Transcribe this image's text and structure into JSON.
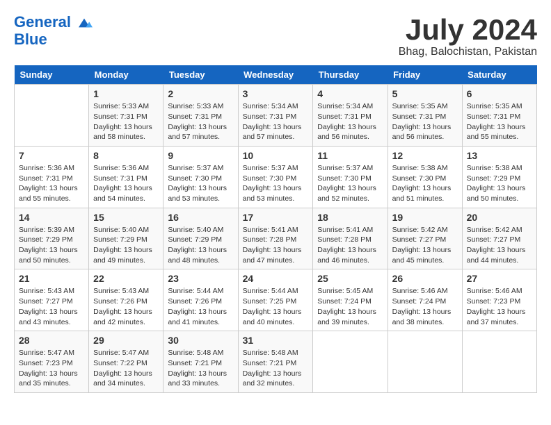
{
  "logo": {
    "line1": "General",
    "line2": "Blue"
  },
  "title": "July 2024",
  "location": "Bhag, Balochistan, Pakistan",
  "headers": [
    "Sunday",
    "Monday",
    "Tuesday",
    "Wednesday",
    "Thursday",
    "Friday",
    "Saturday"
  ],
  "weeks": [
    [
      {
        "day": "",
        "info": ""
      },
      {
        "day": "1",
        "info": "Sunrise: 5:33 AM\nSunset: 7:31 PM\nDaylight: 13 hours\nand 58 minutes."
      },
      {
        "day": "2",
        "info": "Sunrise: 5:33 AM\nSunset: 7:31 PM\nDaylight: 13 hours\nand 57 minutes."
      },
      {
        "day": "3",
        "info": "Sunrise: 5:34 AM\nSunset: 7:31 PM\nDaylight: 13 hours\nand 57 minutes."
      },
      {
        "day": "4",
        "info": "Sunrise: 5:34 AM\nSunset: 7:31 PM\nDaylight: 13 hours\nand 56 minutes."
      },
      {
        "day": "5",
        "info": "Sunrise: 5:35 AM\nSunset: 7:31 PM\nDaylight: 13 hours\nand 56 minutes."
      },
      {
        "day": "6",
        "info": "Sunrise: 5:35 AM\nSunset: 7:31 PM\nDaylight: 13 hours\nand 55 minutes."
      }
    ],
    [
      {
        "day": "7",
        "info": "Sunrise: 5:36 AM\nSunset: 7:31 PM\nDaylight: 13 hours\nand 55 minutes."
      },
      {
        "day": "8",
        "info": "Sunrise: 5:36 AM\nSunset: 7:31 PM\nDaylight: 13 hours\nand 54 minutes."
      },
      {
        "day": "9",
        "info": "Sunrise: 5:37 AM\nSunset: 7:30 PM\nDaylight: 13 hours\nand 53 minutes."
      },
      {
        "day": "10",
        "info": "Sunrise: 5:37 AM\nSunset: 7:30 PM\nDaylight: 13 hours\nand 53 minutes."
      },
      {
        "day": "11",
        "info": "Sunrise: 5:37 AM\nSunset: 7:30 PM\nDaylight: 13 hours\nand 52 minutes."
      },
      {
        "day": "12",
        "info": "Sunrise: 5:38 AM\nSunset: 7:30 PM\nDaylight: 13 hours\nand 51 minutes."
      },
      {
        "day": "13",
        "info": "Sunrise: 5:38 AM\nSunset: 7:29 PM\nDaylight: 13 hours\nand 50 minutes."
      }
    ],
    [
      {
        "day": "14",
        "info": "Sunrise: 5:39 AM\nSunset: 7:29 PM\nDaylight: 13 hours\nand 50 minutes."
      },
      {
        "day": "15",
        "info": "Sunrise: 5:40 AM\nSunset: 7:29 PM\nDaylight: 13 hours\nand 49 minutes."
      },
      {
        "day": "16",
        "info": "Sunrise: 5:40 AM\nSunset: 7:29 PM\nDaylight: 13 hours\nand 48 minutes."
      },
      {
        "day": "17",
        "info": "Sunrise: 5:41 AM\nSunset: 7:28 PM\nDaylight: 13 hours\nand 47 minutes."
      },
      {
        "day": "18",
        "info": "Sunrise: 5:41 AM\nSunset: 7:28 PM\nDaylight: 13 hours\nand 46 minutes."
      },
      {
        "day": "19",
        "info": "Sunrise: 5:42 AM\nSunset: 7:27 PM\nDaylight: 13 hours\nand 45 minutes."
      },
      {
        "day": "20",
        "info": "Sunrise: 5:42 AM\nSunset: 7:27 PM\nDaylight: 13 hours\nand 44 minutes."
      }
    ],
    [
      {
        "day": "21",
        "info": "Sunrise: 5:43 AM\nSunset: 7:27 PM\nDaylight: 13 hours\nand 43 minutes."
      },
      {
        "day": "22",
        "info": "Sunrise: 5:43 AM\nSunset: 7:26 PM\nDaylight: 13 hours\nand 42 minutes."
      },
      {
        "day": "23",
        "info": "Sunrise: 5:44 AM\nSunset: 7:26 PM\nDaylight: 13 hours\nand 41 minutes."
      },
      {
        "day": "24",
        "info": "Sunrise: 5:44 AM\nSunset: 7:25 PM\nDaylight: 13 hours\nand 40 minutes."
      },
      {
        "day": "25",
        "info": "Sunrise: 5:45 AM\nSunset: 7:24 PM\nDaylight: 13 hours\nand 39 minutes."
      },
      {
        "day": "26",
        "info": "Sunrise: 5:46 AM\nSunset: 7:24 PM\nDaylight: 13 hours\nand 38 minutes."
      },
      {
        "day": "27",
        "info": "Sunrise: 5:46 AM\nSunset: 7:23 PM\nDaylight: 13 hours\nand 37 minutes."
      }
    ],
    [
      {
        "day": "28",
        "info": "Sunrise: 5:47 AM\nSunset: 7:23 PM\nDaylight: 13 hours\nand 35 minutes."
      },
      {
        "day": "29",
        "info": "Sunrise: 5:47 AM\nSunset: 7:22 PM\nDaylight: 13 hours\nand 34 minutes."
      },
      {
        "day": "30",
        "info": "Sunrise: 5:48 AM\nSunset: 7:21 PM\nDaylight: 13 hours\nand 33 minutes."
      },
      {
        "day": "31",
        "info": "Sunrise: 5:48 AM\nSunset: 7:21 PM\nDaylight: 13 hours\nand 32 minutes."
      },
      {
        "day": "",
        "info": ""
      },
      {
        "day": "",
        "info": ""
      },
      {
        "day": "",
        "info": ""
      }
    ]
  ]
}
